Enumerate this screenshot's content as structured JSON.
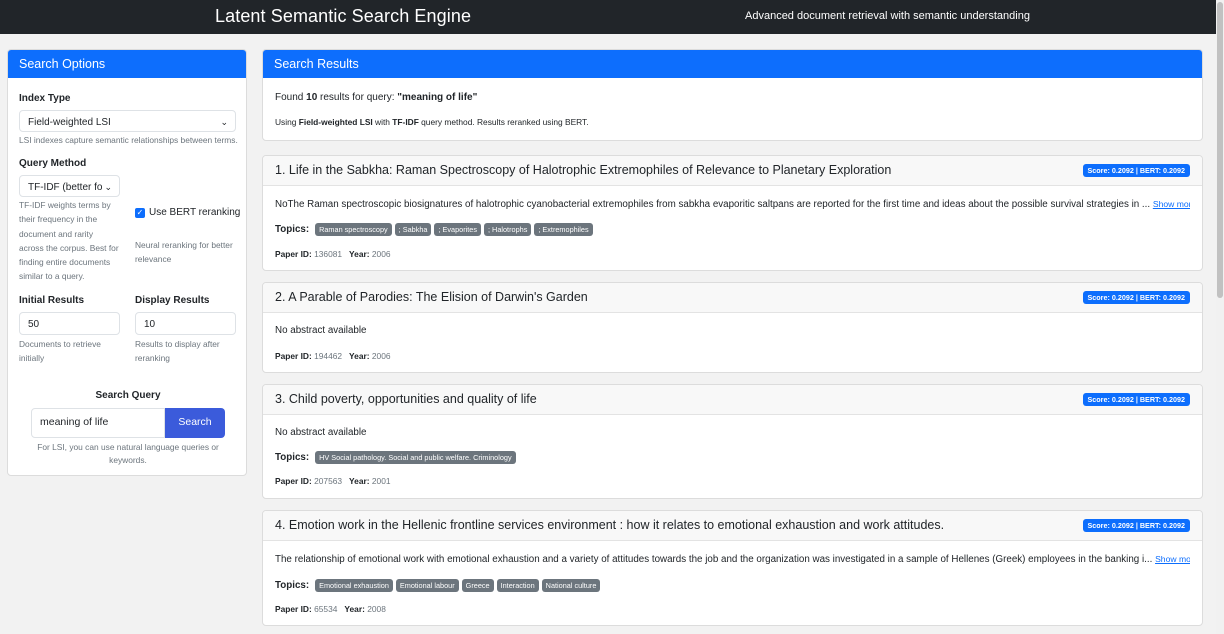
{
  "header": {
    "title": "Latent Semantic Search Engine",
    "tagline": "Advanced document retrieval with semantic understanding"
  },
  "sidebar": {
    "heading": "Search Options",
    "index_type": {
      "label": "Index Type",
      "value": "Field-weighted LSI",
      "help": "LSI indexes capture semantic relationships between terms."
    },
    "query_method": {
      "label": "Query Method",
      "value": "TF-IDF (better for",
      "help": [
        "TF-IDF weights terms by",
        "their frequency in the",
        "document and rarity",
        "across the corpus. Best for",
        "finding entire documents",
        "similar to a query."
      ]
    },
    "bert": {
      "label": "Use BERT reranking",
      "checked": true,
      "help": [
        "Neural reranking for better",
        "relevance"
      ]
    },
    "initial_results": {
      "label": "Initial Results",
      "value": "50",
      "help": [
        "Documents to retrieve",
        "initially"
      ]
    },
    "display_results": {
      "label": "Display Results",
      "value": "10",
      "help": [
        "Results to display after",
        "reranking"
      ]
    },
    "search_query": {
      "label": "Search Query",
      "value": "meaning of life",
      "button": "Search",
      "help": [
        "For LSI, you can use natural language queries or",
        "keywords."
      ]
    }
  },
  "results": {
    "heading": "Search Results",
    "summary": {
      "prefix": "Found ",
      "count": "10",
      "middle": " results for query: ",
      "query": "\"meaning of life\""
    },
    "method": {
      "p1": "Using ",
      "index": "Field-weighted LSI",
      "p2": " with ",
      "query_method": "TF-IDF",
      "p3": " query method. Results reranked using BERT."
    },
    "labels": {
      "topics": "Topics:",
      "paper_id": "Paper ID:",
      "year": "Year:",
      "show_more": "Show more"
    },
    "items": [
      {
        "title": "1. Life in the Sabkha: Raman Spectroscopy of Halotrophic Extremophiles of Relevance to Planetary Exploration",
        "score": "Score: 0.2092 | BERT: 0.2092",
        "abstract": "NoThe Raman spectroscopic biosignatures of halotrophic cyanobacterial extremophiles from sabkha evaporitic saltpans are reported for the first time and ideas about the possible survival strategies in ...",
        "topics": [
          "Raman spectroscopy",
          "; Sabkha",
          "; Evaporites",
          "; Halotrophs",
          "; Extremophiles"
        ],
        "paper_id": "136081",
        "year": "2006"
      },
      {
        "title": "2. A Parable of Parodies: The Elision of Darwin's Garden",
        "score": "Score: 0.2092 | BERT: 0.2092",
        "abstract": "No abstract available",
        "topics": [],
        "paper_id": "194462",
        "year": "2006"
      },
      {
        "title": "3. Child poverty, opportunities and quality of life",
        "score": "Score: 0.2092 | BERT: 0.2092",
        "abstract": "No abstract available",
        "topics": [
          "HV Social pathology. Social and public welfare. Criminology"
        ],
        "paper_id": "207563",
        "year": "2001"
      },
      {
        "title": "4. Emotion work in the Hellenic frontline services environment : how it relates to emotional exhaustion and work attitudes.",
        "score": "Score: 0.2092 | BERT: 0.2092",
        "abstract": "The relationship of emotional work with emotional exhaustion and a variety of attitudes towards the job and the organization was investigated in a sample of Hellenes (Greek) employees in the banking i...",
        "topics": [
          "Emotional exhaustion",
          "Emotional labour",
          "Greece",
          "Interaction",
          "National culture"
        ],
        "paper_id": "65534",
        "year": "2008"
      }
    ]
  }
}
